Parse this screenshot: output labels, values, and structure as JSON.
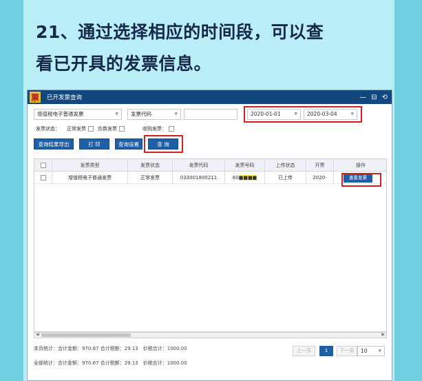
{
  "headline": {
    "line1": "21、通过选择相应的时间段，可以查",
    "line2": "看已开具的发票信息。"
  },
  "window": {
    "logo_char": "票",
    "title": "已开发票查询",
    "controls": {
      "minimize": "—",
      "restore": "⊟",
      "back": "⟲"
    }
  },
  "filters": {
    "invoice_type": "增值税电子普通发票",
    "field_select": "发票代码",
    "keyword_value": "",
    "date_start": "2020-01-01",
    "date_end": "2020-03-04"
  },
  "status_filters": {
    "label": "发票状态：",
    "normal": "正常发票",
    "negative": "负数发票",
    "void_label": "收购发票："
  },
  "buttons": {
    "export": "查询结果导出",
    "print": "打 印",
    "settings": "查询设置",
    "query": "查 询"
  },
  "table": {
    "headers": [
      "发票类型",
      "发票状态",
      "发票代码",
      "发票号码",
      "上传状态",
      "开票",
      "操作"
    ],
    "rows": [
      {
        "type": "增值税电子普通发票",
        "status": "正常发票",
        "code": "033001800211",
        "number": "60",
        "number_masked": "■■■■",
        "upload": "已上传",
        "date": "2020-",
        "action": "查看发票"
      }
    ]
  },
  "summary": {
    "page_total": "本页统计：合计金额：970.87 合计税额：29.13　价税合计：1000.00",
    "all_total": "全部统计：合计金额：970.87 合计税额：29.13　价税合计：1000.00"
  },
  "pagination": {
    "prev": "上一页",
    "current": "1",
    "next": "下一页",
    "page_size": "10"
  },
  "colors": {
    "accent": "#1f5fa6",
    "titlebar": "#12467f",
    "highlight_box": "#d21f1f"
  }
}
